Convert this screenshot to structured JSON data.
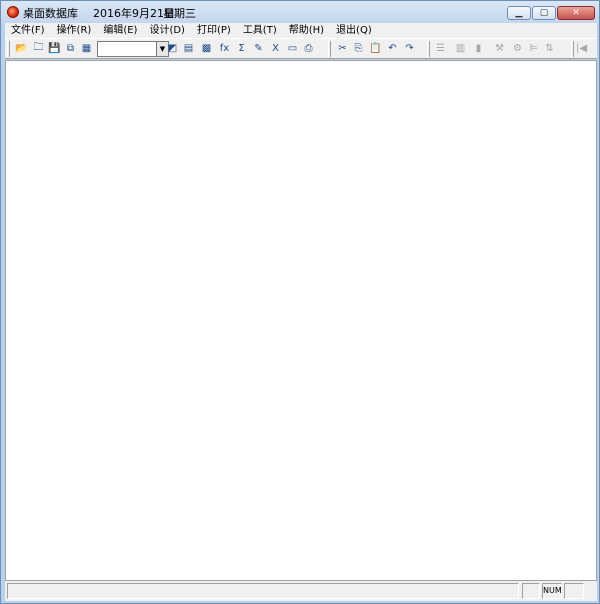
{
  "window": {
    "title": "桌面数据库",
    "date": "2016年9月21日",
    "weekday": "星期三",
    "controls": {
      "minimize": "▁",
      "maximize": "▢",
      "close": "✕"
    }
  },
  "menu": [
    "文件(F)",
    "操作(R)",
    "编辑(E)",
    "设计(D)",
    "打印(P)",
    "工具(T)",
    "帮助(H)",
    "退出(Q)"
  ],
  "toolbar": {
    "combo_value": "",
    "icons": [
      {
        "name": "open-folder-icon",
        "glyph": "📂",
        "enabled": true
      },
      {
        "name": "new-folder-icon",
        "glyph": "🗀",
        "enabled": true
      },
      {
        "name": "save-icon",
        "glyph": "💾",
        "enabled": true
      },
      {
        "name": "save-as-icon",
        "glyph": "⧉",
        "enabled": true
      },
      {
        "name": "table-icon",
        "glyph": "▦",
        "enabled": true
      },
      {
        "name": "eraser-icon",
        "glyph": "◩",
        "enabled": true
      },
      {
        "name": "books-icon",
        "glyph": "▤",
        "enabled": true
      },
      {
        "name": "grid-icon",
        "glyph": "▩",
        "enabled": true
      },
      {
        "name": "function-icon",
        "glyph": "fx",
        "enabled": true
      },
      {
        "name": "sum-icon",
        "glyph": "Σ",
        "enabled": true
      },
      {
        "name": "edit-note-icon",
        "glyph": "✎",
        "enabled": true
      },
      {
        "name": "excel-icon",
        "glyph": "X",
        "enabled": true
      },
      {
        "name": "form-icon",
        "glyph": "▭",
        "enabled": true
      },
      {
        "name": "print-icon",
        "glyph": "⎙",
        "enabled": true
      },
      {
        "name": "cut-icon",
        "glyph": "✂",
        "enabled": true
      },
      {
        "name": "copy-icon",
        "glyph": "⎘",
        "enabled": true
      },
      {
        "name": "paste-icon",
        "glyph": "📋",
        "enabled": true
      },
      {
        "name": "undo-icon",
        "glyph": "↶",
        "enabled": true
      },
      {
        "name": "redo-icon",
        "glyph": "↷",
        "enabled": true
      },
      {
        "name": "list-indent-icon",
        "glyph": "☰",
        "enabled": false
      },
      {
        "name": "insert-row-icon",
        "glyph": "▥",
        "enabled": false
      },
      {
        "name": "document-icon",
        "glyph": "▮",
        "enabled": false
      },
      {
        "name": "tools-icon",
        "glyph": "⚒",
        "enabled": false
      },
      {
        "name": "settings-icon",
        "glyph": "⚙",
        "enabled": false
      },
      {
        "name": "align-left-icon",
        "glyph": "⊫",
        "enabled": false
      },
      {
        "name": "sort-icon",
        "glyph": "⇅",
        "enabled": false
      },
      {
        "name": "first-record-icon",
        "glyph": "|◀",
        "enabled": false
      }
    ]
  },
  "status": {
    "message": "",
    "indicator1": "",
    "num": "NUM",
    "indicator3": ""
  }
}
